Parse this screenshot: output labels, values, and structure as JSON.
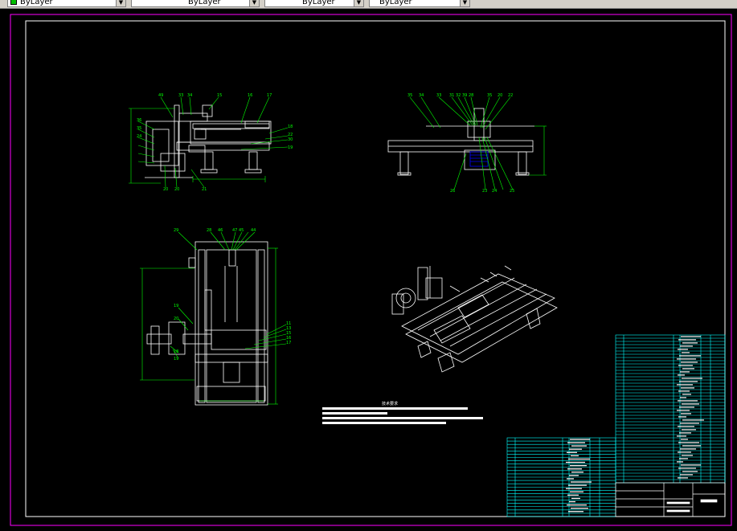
{
  "toolbar": {
    "color_combo": {
      "value": "ByLayer",
      "swatch_color": "#00c000"
    },
    "linetype_combo": {
      "value": "ByLayer"
    },
    "lineweight_combo": {
      "value": "ByLayer"
    },
    "plotstyle_combo": {
      "value": "ByLayer"
    }
  },
  "drawing": {
    "background_color": "#000000",
    "layout_border_color": "#ff00ff",
    "sheet_border_color": "#ffffff",
    "geometry_color": "#ffffff",
    "dimension_color": "#00ff00",
    "title_block_color": "#00ffff",
    "hidden_part_color": "#0000ff",
    "notes_heading": "技术要求",
    "top_view_labels": [
      "49",
      "33",
      "34",
      "15",
      "16",
      "17",
      "18",
      "22",
      "30",
      "19",
      "36",
      "35",
      "24",
      "20",
      "20",
      "21"
    ],
    "front_view_labels": [
      "35",
      "34",
      "33",
      "31",
      "32",
      "39",
      "28",
      "35",
      "20",
      "22",
      "26",
      "23",
      "24",
      "25"
    ],
    "side_view_labels": [
      "29",
      "28",
      "46",
      "47",
      "45",
      "44",
      "19",
      "20",
      "11",
      "13",
      "15",
      "16",
      "17",
      "18",
      "19"
    ]
  }
}
